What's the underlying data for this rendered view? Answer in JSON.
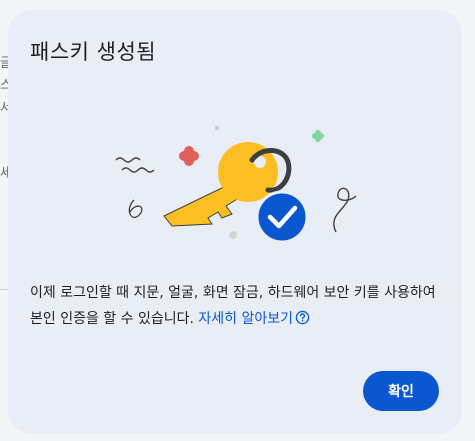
{
  "dialog": {
    "title": "패스키 생성됨",
    "body_text": "이제 로그인할 때 지문, 얼굴, 화면 잠금, 하드웨어 보안 키를 사용하여 본인 인증을 할 수 있습니다. ",
    "learn_more_label": "자세히 알아보기",
    "confirm_label": "확인"
  },
  "background": {
    "fragments": [
      "글",
      "스",
      "서",
      "세"
    ]
  },
  "colors": {
    "dialog_bg": "#e9eef6",
    "accent": "#0b57d0",
    "key_fill": "#fbbf24",
    "check_badge": "#0b57d0",
    "sparkle_red": "#e0605a",
    "sparkle_green": "#7fd6a0"
  },
  "icons": [
    "key-icon",
    "check-badge-icon",
    "help-circle-icon"
  ]
}
